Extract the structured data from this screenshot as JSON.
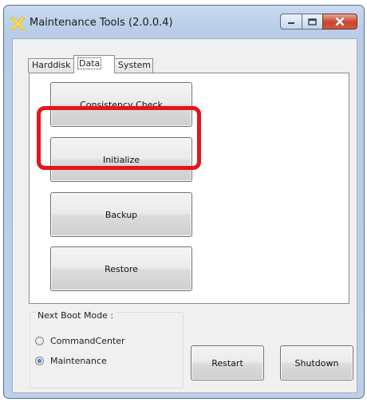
{
  "window": {
    "title": "Maintenance Tools (2.0.0.4)",
    "icon": "yellow-cross-app-icon"
  },
  "caption_buttons": [
    "minimize-icon",
    "maximize-icon",
    "close-icon"
  ],
  "tabs": [
    {
      "label": "Harddisk",
      "active": false
    },
    {
      "label": "Data",
      "active": true
    },
    {
      "label": "System",
      "active": false
    }
  ],
  "data_tab": {
    "buttons": [
      {
        "label": "Consistency Check",
        "highlighted": true
      },
      {
        "label": "Initialize"
      },
      {
        "label": "Backup"
      },
      {
        "label": "Restore"
      }
    ]
  },
  "boot_mode": {
    "label": "Next Boot Mode :",
    "options": [
      {
        "label": "CommandCenter",
        "selected": false
      },
      {
        "label": "Maintenance",
        "selected": true
      }
    ]
  },
  "actions": {
    "restart_label": "Restart",
    "shutdown_label": "Shutdown"
  },
  "colors": {
    "highlight": "#e8131b",
    "close_button": "#c8452c",
    "frame": "#b9cde8"
  }
}
